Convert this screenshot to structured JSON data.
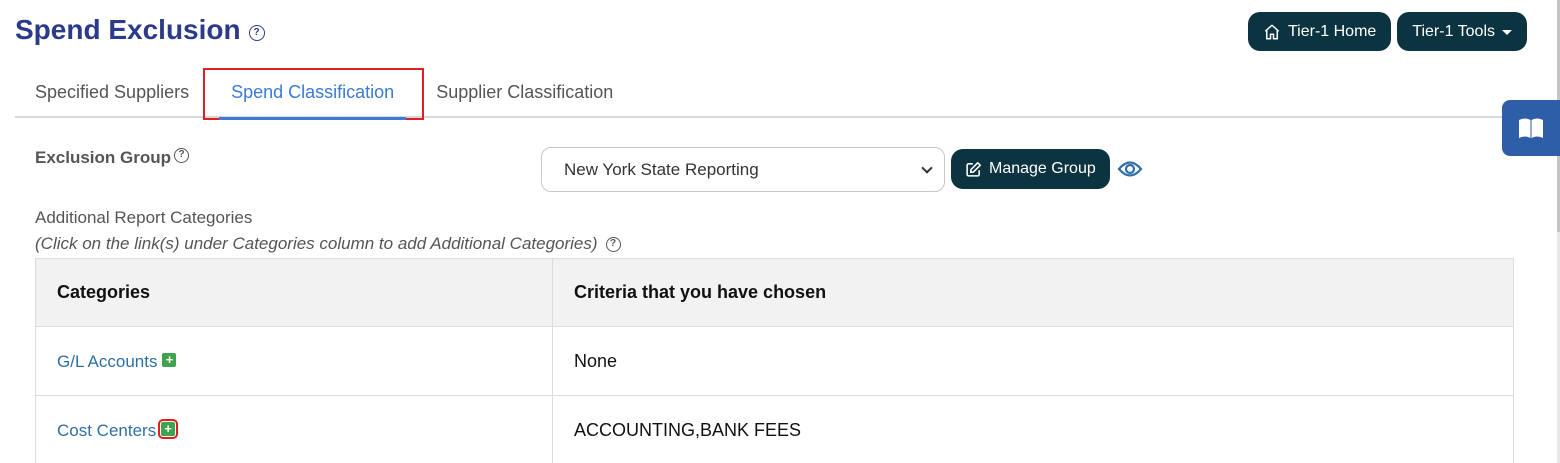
{
  "header": {
    "title": "Spend Exclusion",
    "help_icon": "question-circle-icon",
    "home_label": "Tier-1 Home",
    "tools_label": "Tier-1 Tools"
  },
  "tabs": [
    {
      "label": "Specified Suppliers",
      "active": false
    },
    {
      "label": "Spend Classification",
      "active": true
    },
    {
      "label": "Supplier Classification",
      "active": false
    }
  ],
  "exclusion_group": {
    "label": "Exclusion Group",
    "selected": "New York State Reporting",
    "manage_label": "Manage Group"
  },
  "additional": {
    "label": "Additional Report Categories",
    "hint": "(Click on the link(s) under Categories column to add Additional Categories)"
  },
  "table": {
    "headers": [
      "Categories",
      "Criteria that you have chosen"
    ],
    "rows": [
      {
        "category": "G/L Accounts",
        "criteria": "None"
      },
      {
        "category": "Cost Centers",
        "criteria": "ACCOUNTING,BANK FEES"
      }
    ]
  },
  "colors": {
    "title": "#2b3a8a",
    "dark_button": "#0b3440",
    "active_tab": "#3a7bd5",
    "link": "#2f6fa8",
    "plus": "#3fa34d",
    "highlight": "#e02020"
  }
}
